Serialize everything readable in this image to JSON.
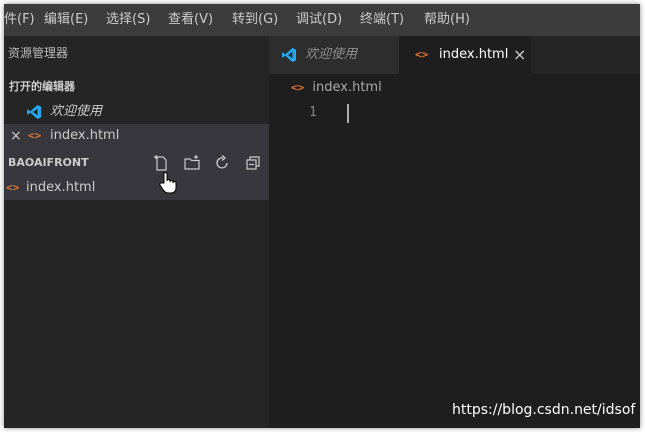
{
  "menubar": {
    "items": [
      "件(F)",
      "编辑(E)",
      "选择(S)",
      "查看(V)",
      "转到(G)",
      "调试(D)",
      "终端(T)",
      "帮助(H)"
    ]
  },
  "sidebar": {
    "title": "资源管理器",
    "open_editors": {
      "header": "打开的编辑器",
      "items": [
        {
          "label": "欢迎使用",
          "icon": "vscode-logo-icon"
        },
        {
          "label": "index.html",
          "icon": "html-file-icon",
          "close": "×"
        }
      ]
    },
    "folder": {
      "header": "BAOAIFRONT",
      "actions": [
        "new-file-icon",
        "new-folder-icon",
        "refresh-icon",
        "collapse-all-icon"
      ],
      "files": [
        {
          "label": "index.html",
          "icon": "html-file-icon"
        }
      ]
    }
  },
  "tabs": [
    {
      "label": "欢迎使用",
      "icon": "vscode-logo-icon",
      "active": false
    },
    {
      "label": "index.html",
      "icon": "html-file-icon",
      "active": true,
      "close": "×"
    }
  ],
  "editor": {
    "breadcrumb": "index.html",
    "line_numbers": [
      "1"
    ]
  },
  "watermark": "https://blog.csdn.net/idsof",
  "colors": {
    "accent_blue": "#23a9f2",
    "html_orange": "#e37933",
    "editor_bg": "#1e1e1e",
    "sidebar_bg": "#252526"
  }
}
